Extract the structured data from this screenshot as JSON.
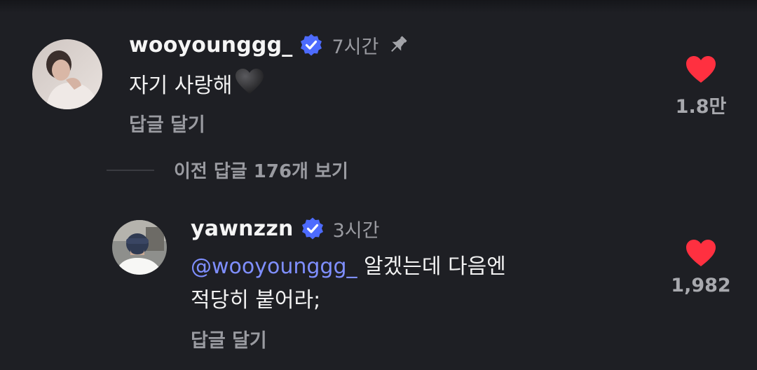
{
  "comment": {
    "username": "wooyounggg_",
    "time": "7시간",
    "text": "자기 사랑해",
    "emoji": "black-heart",
    "reply_label": "답글 달기",
    "likes": "1.8만",
    "pinned": true,
    "verified": true
  },
  "view_previous": {
    "label": "이전 답글 176개 보기"
  },
  "reply": {
    "username": "yawnzzn",
    "time": "3시간",
    "mention": "@wooyounggg_",
    "text_line1": " 알겠는데 다음엔",
    "text_line2": "적당히 붙어라;",
    "reply_label": "답글 달기",
    "likes": "1,982",
    "verified": true
  },
  "colors": {
    "background": "#1e1f24",
    "like_red": "#ff3040",
    "verified_blue": "#4d6bfe",
    "mention": "#7f8fff",
    "muted": "#9a9ba1"
  }
}
